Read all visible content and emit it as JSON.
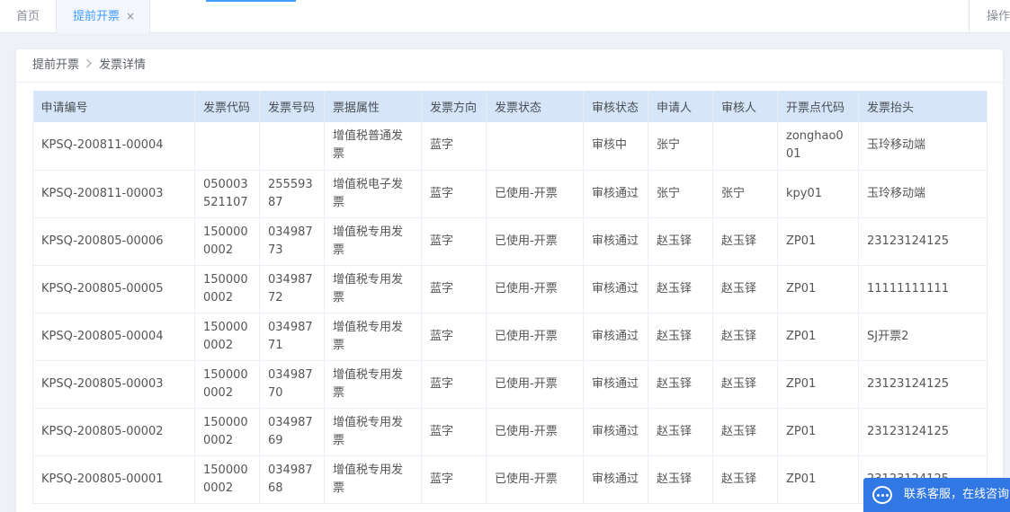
{
  "tabs": {
    "home": "首页",
    "active": "提前开票",
    "close": "×",
    "ops": "操作"
  },
  "breadcrumb": {
    "parent": "提前开票",
    "current": "发票详情"
  },
  "table": {
    "headers": [
      "申请编号",
      "发票代码",
      "发票号码",
      "票据属性",
      "发票方向",
      "发票状态",
      "审核状态",
      "申请人",
      "审核人",
      "开票点代码",
      "发票抬头"
    ],
    "rows": [
      [
        "KPSQ-200811-00004",
        "",
        "",
        "增值税普通发票",
        "蓝字",
        "",
        "审核中",
        "张宁",
        "",
        "zonghao001",
        "玉玲移动端"
      ],
      [
        "KPSQ-200811-00003",
        "050003521107",
        "25559387",
        "增值税电子发票",
        "蓝字",
        "已使用-开票",
        "审核通过",
        "张宁",
        "张宁",
        "kpy01",
        "玉玲移动端"
      ],
      [
        "KPSQ-200805-00006",
        "1500000002",
        "03498773",
        "增值税专用发票",
        "蓝字",
        "已使用-开票",
        "审核通过",
        "赵玉铎",
        "赵玉铎",
        "ZP01",
        "23123124125"
      ],
      [
        "KPSQ-200805-00005",
        "1500000002",
        "03498772",
        "增值税专用发票",
        "蓝字",
        "已使用-开票",
        "审核通过",
        "赵玉铎",
        "赵玉铎",
        "ZP01",
        "11111111111"
      ],
      [
        "KPSQ-200805-00004",
        "1500000002",
        "03498771",
        "增值税专用发票",
        "蓝字",
        "已使用-开票",
        "审核通过",
        "赵玉铎",
        "赵玉铎",
        "ZP01",
        "SJ开票2"
      ],
      [
        "KPSQ-200805-00003",
        "1500000002",
        "03498770",
        "增值税专用发票",
        "蓝字",
        "已使用-开票",
        "审核通过",
        "赵玉铎",
        "赵玉铎",
        "ZP01",
        "23123124125"
      ],
      [
        "KPSQ-200805-00002",
        "1500000002",
        "03498769",
        "增值税专用发票",
        "蓝字",
        "已使用-开票",
        "审核通过",
        "赵玉铎",
        "赵玉铎",
        "ZP01",
        "23123124125"
      ],
      [
        "KPSQ-200805-00001",
        "1500000002",
        "03498768",
        "增值税专用发票",
        "蓝字",
        "已使用-开票",
        "审核通过",
        "赵玉铎",
        "赵玉铎",
        "ZP01",
        "23123124125"
      ]
    ]
  },
  "chat": {
    "icon": "chat-bubble-icon",
    "label": "联系客服，在线咨询"
  },
  "colors": {
    "accent": "#409eff",
    "header_bg": "#d6e6f8",
    "chat_bg": "#3178e4"
  }
}
